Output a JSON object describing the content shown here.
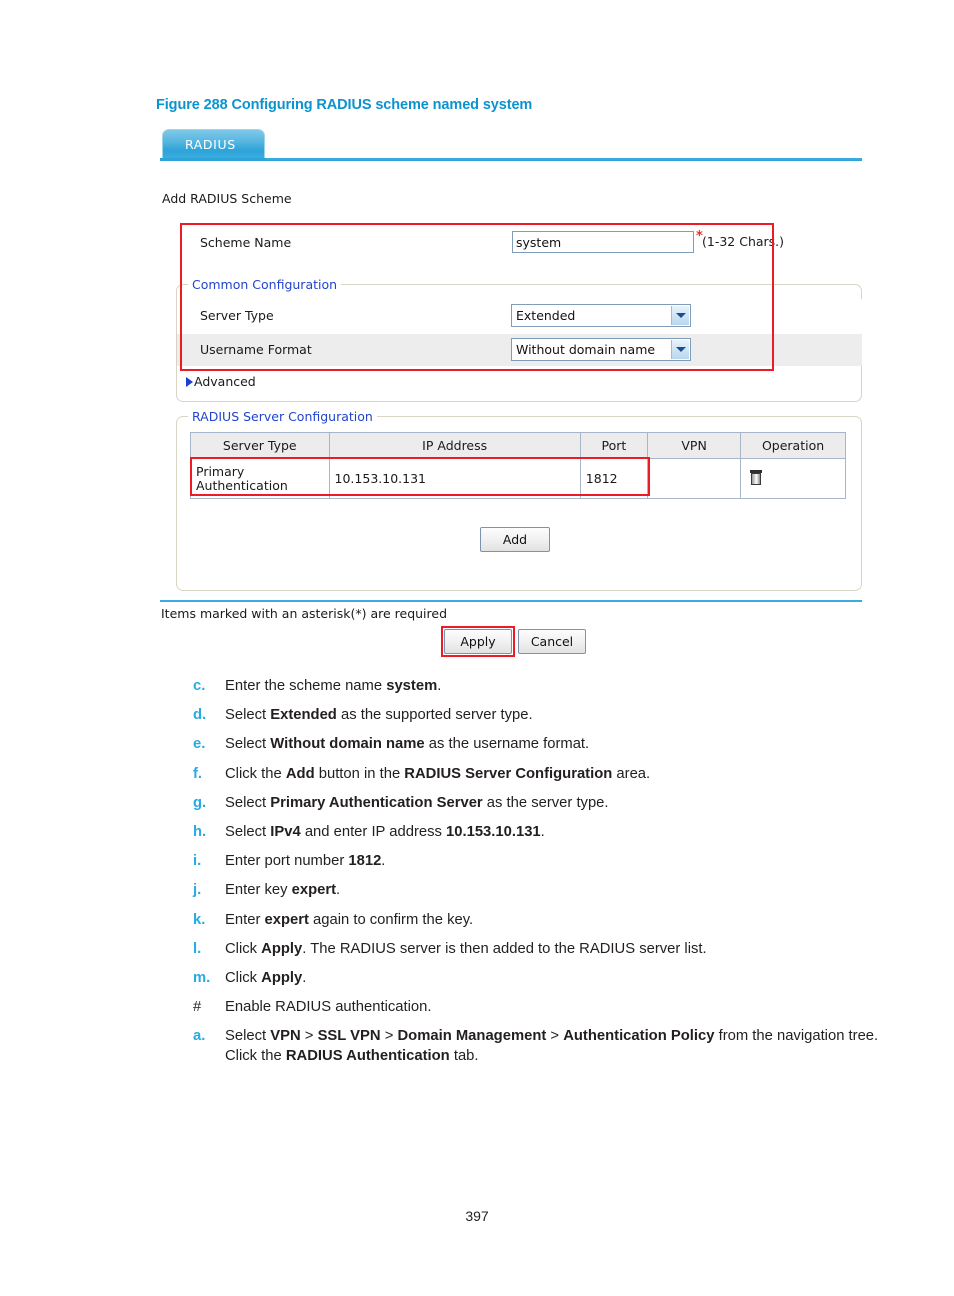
{
  "figure": {
    "caption": "Figure 288 Configuring RADIUS scheme named system"
  },
  "screenshot": {
    "tab": {
      "label": "RADIUS"
    },
    "section_title": "Add RADIUS Scheme",
    "scheme_name": {
      "label": "Scheme Name",
      "value": "system",
      "asterisk": "*",
      "hint": "(1-32 Chars.)"
    },
    "common_configuration": {
      "legend": "Common Configuration",
      "server_type": {
        "label": "Server Type",
        "value": "Extended"
      },
      "username_format": {
        "label": "Username Format",
        "value": "Without domain name"
      },
      "advanced": "Advanced"
    },
    "server_configuration": {
      "legend": "RADIUS Server Configuration",
      "columns": [
        "Server Type",
        "IP Address",
        "Port",
        "VPN",
        "Operation"
      ],
      "rows": [
        {
          "server_type": "Primary Authentication",
          "ip_address": "10.153.10.131",
          "port": "1812",
          "vpn": "",
          "operation_icon": "trash-icon"
        }
      ],
      "add_label": "Add"
    },
    "footer": {
      "required_note": "Items marked with an asterisk(*) are required",
      "apply_label": "Apply",
      "cancel_label": "Cancel"
    }
  },
  "steps": [
    {
      "marker": "c.",
      "parts": [
        {
          "t": "Enter the scheme name ",
          "b": false
        },
        {
          "t": "system",
          "b": true
        },
        {
          "t": ".",
          "b": false
        }
      ]
    },
    {
      "marker": "d.",
      "parts": [
        {
          "t": "Select ",
          "b": false
        },
        {
          "t": "Extended",
          "b": true
        },
        {
          "t": " as the supported server type.",
          "b": false
        }
      ]
    },
    {
      "marker": "e.",
      "parts": [
        {
          "t": "Select ",
          "b": false
        },
        {
          "t": "Without domain name",
          "b": true
        },
        {
          "t": " as the username format.",
          "b": false
        }
      ]
    },
    {
      "marker": "f.",
      "parts": [
        {
          "t": "Click the ",
          "b": false
        },
        {
          "t": "Add",
          "b": true
        },
        {
          "t": " button in the ",
          "b": false
        },
        {
          "t": "RADIUS Server Configuration",
          "b": true
        },
        {
          "t": " area.",
          "b": false
        }
      ]
    },
    {
      "marker": "g.",
      "parts": [
        {
          "t": "Select ",
          "b": false
        },
        {
          "t": "Primary Authentication Server",
          "b": true
        },
        {
          "t": " as the server type.",
          "b": false
        }
      ]
    },
    {
      "marker": "h.",
      "parts": [
        {
          "t": "Select ",
          "b": false
        },
        {
          "t": "IPv4",
          "b": true
        },
        {
          "t": " and enter IP address ",
          "b": false
        },
        {
          "t": "10.153.10.131",
          "b": true
        },
        {
          "t": ".",
          "b": false
        }
      ]
    },
    {
      "marker": "i.",
      "parts": [
        {
          "t": "Enter port number ",
          "b": false
        },
        {
          "t": "1812",
          "b": true
        },
        {
          "t": ".",
          "b": false
        }
      ]
    },
    {
      "marker": "j.",
      "parts": [
        {
          "t": "Enter key ",
          "b": false
        },
        {
          "t": "expert",
          "b": true
        },
        {
          "t": ".",
          "b": false
        }
      ]
    },
    {
      "marker": "k.",
      "parts": [
        {
          "t": "Enter ",
          "b": false
        },
        {
          "t": "expert",
          "b": true
        },
        {
          "t": " again to confirm the key.",
          "b": false
        }
      ]
    },
    {
      "marker": "l.",
      "parts": [
        {
          "t": "Click ",
          "b": false
        },
        {
          "t": "Apply",
          "b": true
        },
        {
          "t": ". The RADIUS server is then added to the RADIUS server list.",
          "b": false
        }
      ]
    },
    {
      "marker": "m.",
      "parts": [
        {
          "t": "Click ",
          "b": false
        },
        {
          "t": "Apply",
          "b": true
        },
        {
          "t": ".",
          "b": false
        }
      ]
    },
    {
      "marker": "#",
      "nomarker": true,
      "parts": [
        {
          "t": "Enable RADIUS authentication.",
          "b": false
        }
      ]
    },
    {
      "marker": "a.",
      "parts": [
        {
          "t": "Select ",
          "b": false
        },
        {
          "t": "VPN",
          "b": true
        },
        {
          "t": " > ",
          "b": false
        },
        {
          "t": "SSL VPN",
          "b": true
        },
        {
          "t": " > ",
          "b": false
        },
        {
          "t": "Domain Management",
          "b": true
        },
        {
          "t": " > ",
          "b": false
        },
        {
          "t": "Authentication Policy",
          "b": true
        },
        {
          "t": " from the navigation tree. Click the ",
          "b": false
        },
        {
          "t": "RADIUS Authentication",
          "b": true
        },
        {
          "t": " tab.",
          "b": false
        }
      ]
    }
  ],
  "page_number": "397"
}
